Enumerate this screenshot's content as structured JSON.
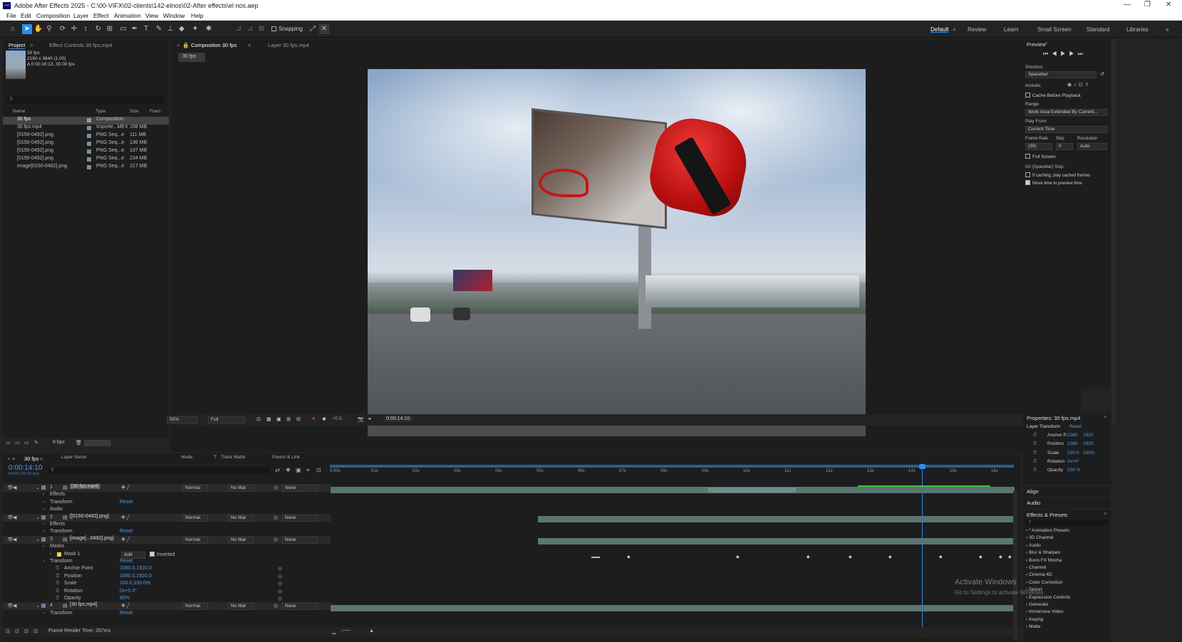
{
  "app": {
    "title": "Adobe After Effects 2025 - C:\\00-VIFX\\02-clients\\142-elnos\\02-After effects\\el nos.aep"
  },
  "menu": [
    "File",
    "Edit",
    "Composition",
    "Layer",
    "Effect",
    "Animation",
    "View",
    "Window",
    "Help"
  ],
  "toolbar": {
    "snapping": "Snapping"
  },
  "workspaces": [
    "Default",
    "Review",
    "Learn",
    "Small Screen",
    "Standard",
    "Libraries"
  ],
  "project": {
    "tab": "Project",
    "effect_tab": "Effect Controls 30 fps.mp4",
    "item_name": "30 fps",
    "item_dims": "2160 x 3840 (1.00)",
    "item_dur": "Δ 0:00:16:13, 30.00 fps",
    "cols": [
      "Name",
      "Type",
      "Size",
      "Fram"
    ],
    "items": [
      {
        "name": "30 fps",
        "type": "Composition",
        "size": ""
      },
      {
        "name": "30 fps.mp4",
        "type": "Importe...MEX",
        "size": "158 MB"
      },
      {
        "name": "[0150-0492].png",
        "type": "PNG Seq...e",
        "size": "111 MB"
      },
      {
        "name": "[0150-0492].png",
        "type": "PNG Seq...e",
        "size": "136 MB"
      },
      {
        "name": "[0150-0492].png",
        "type": "PNG Seq...e",
        "size": "137 MB"
      },
      {
        "name": "[0150-0492].png",
        "type": "PNG Seq...e",
        "size": "234 MB"
      },
      {
        "name": "image[0150-0492].png",
        "type": "PNG Seq...e",
        "size": "217 MB"
      }
    ],
    "bpc": "8 bpc"
  },
  "viewer": {
    "comp_tab": "Composition 30 fps",
    "layer_tab": "Layer 30 fps.mp4",
    "crumb": "30 fps",
    "zoom": "50%",
    "quality": "Full",
    "exposure": "+0.0",
    "timecode": "0:00:14:10"
  },
  "timeline": {
    "tab": "30 fps",
    "timecode": "0:00:14:10",
    "frames": "00430 (30.00 fps)",
    "headers": [
      "Layer Name",
      "Mode",
      "T",
      "Track Matte",
      "Parent & Link"
    ],
    "ruler": [
      "0:00s",
      "01s",
      "02s",
      "03s",
      "04s",
      "05s",
      "06s",
      "07s",
      "08s",
      "09s",
      "10s",
      "11s",
      "12s",
      "13s",
      "14s",
      "15s",
      "16s"
    ],
    "rows": [
      {
        "kind": "layer",
        "num": "1",
        "name": "[30 fps.mp4]",
        "mode": "Normal",
        "matte": "No Mat",
        "parent": "None"
      },
      {
        "kind": "prop",
        "name": "Effects"
      },
      {
        "kind": "prop",
        "name": "Transform",
        "val": "Reset"
      },
      {
        "kind": "prop",
        "name": "Audio"
      },
      {
        "kind": "layer",
        "num": "2",
        "name": "[[0150-0492].png]",
        "mode": "Normal",
        "matte": "No Mat",
        "parent": "None"
      },
      {
        "kind": "prop",
        "name": "Effects"
      },
      {
        "kind": "prop",
        "name": "Transform",
        "val": "Reset"
      },
      {
        "kind": "layer",
        "num": "3",
        "name": "[image[...0492].png]",
        "mode": "Normal",
        "matte": "No Mat",
        "parent": "None"
      },
      {
        "kind": "prop",
        "name": "Masks"
      },
      {
        "kind": "mask",
        "name": "Mask 1",
        "mode": "Add",
        "inv": "Inverted"
      },
      {
        "kind": "prop",
        "name": "Transform",
        "val": "Reset"
      },
      {
        "kind": "sub",
        "name": "Anchor Point",
        "val": "1080.0,1920.0"
      },
      {
        "kind": "sub",
        "name": "Position",
        "val": "1080.0,1920.0"
      },
      {
        "kind": "sub",
        "name": "Scale",
        "val": "100.0,100.0%"
      },
      {
        "kind": "sub",
        "name": "Rotation",
        "val": "0x+0.0°"
      },
      {
        "kind": "sub",
        "name": "Opacity",
        "val": "80%"
      },
      {
        "kind": "layer",
        "num": "4",
        "name": "[30 fps.mp4]",
        "mode": "Normal",
        "matte": "No Mat",
        "parent": "None"
      },
      {
        "kind": "prop",
        "name": "Transform",
        "val": "Reset"
      }
    ],
    "render_time": "Frame Render Time: 287ms"
  },
  "preview": {
    "title": "Preview",
    "shortcut_label": "Shortcut",
    "shortcut": "Spacebar",
    "include": "Include:",
    "cache": "Cache Before Playback",
    "range_label": "Range",
    "range": "Work Area Extended By Current...",
    "playfrom_label": "Play From",
    "playfrom": "Current Time",
    "fr_label": "Frame Rate",
    "skip_label": "Skip",
    "res_label": "Resolution",
    "fr": "(30)",
    "skip": "0",
    "res": "Auto",
    "fullscreen": "Full Screen",
    "stop_label": "On (Spacebar) Stop:",
    "ifcache": "If caching, play cached frames",
    "move": "Move time to preview time"
  },
  "properties": {
    "title": "Properties: 30 fps.mp4",
    "section": "Layer Transform",
    "reset": "Reset",
    "items": [
      {
        "name": "Anchor P...",
        "v1": "1080",
        "v2": "1920"
      },
      {
        "name": "Position",
        "v1": "1080",
        "v2": "1920"
      },
      {
        "name": "Scale",
        "v1": "100.0",
        "v2": "100%"
      },
      {
        "name": "Rotation",
        "v1": "0x+0°",
        "v2": ""
      },
      {
        "name": "Opacity",
        "v1": "100 %",
        "v2": ""
      }
    ]
  },
  "side": {
    "align": "Align",
    "audio": "Audio",
    "effects_title": "Effects & Presets",
    "effects": [
      "* Animation Presets",
      "3D Channel",
      "Audio",
      "Blur & Sharpen",
      "Boris FX Mocha",
      "Channel",
      "Cinema 4D",
      "Color Correction",
      "Distort",
      "Expression Controls",
      "Generate",
      "Immersive Video",
      "Keying",
      "Matte"
    ]
  },
  "watermark": {
    "line1": "Activate Windows",
    "line2": "Go to Settings to activate Windows."
  }
}
